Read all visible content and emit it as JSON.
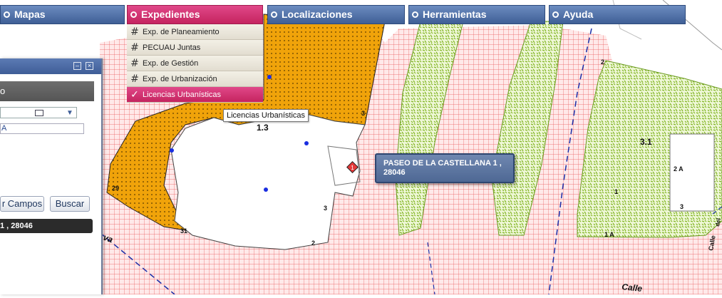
{
  "menu": {
    "items": [
      {
        "label": "Mapas"
      },
      {
        "label": "Expedientes"
      },
      {
        "label": "Localizaciones"
      },
      {
        "label": "Herramientas"
      },
      {
        "label": "Ayuda"
      }
    ]
  },
  "dropdown": {
    "items": [
      {
        "label": "Exp. de Planeamiento"
      },
      {
        "label": "PECUAU Juntas"
      },
      {
        "label": "Exp. de Gestión"
      },
      {
        "label": "Exp. de Urbanización"
      },
      {
        "label": "Licencias Urbanísticas"
      }
    ]
  },
  "tooltip": {
    "text": "Licencias Urbanísticas"
  },
  "popup": {
    "text": "PASEO DE LA CASTELLANA 1 , 28046"
  },
  "panel": {
    "title": "o",
    "input_value": "A",
    "clear_label": "r Campos",
    "search_label": "Buscar",
    "result": "1 , 28046"
  },
  "map": {
    "marker_label": "1",
    "labels": [
      "1.3",
      "3",
      "29",
      "31",
      "3",
      "2",
      "2",
      "3.1",
      "2 A",
      "1",
      "3",
      "1 A",
      "Calle",
      "Calle",
      "del",
      "va"
    ]
  },
  "colors": {
    "menu_blue": "#4f6fa6",
    "menu_active": "#d2336f",
    "orange_parcel": "#f0a30a",
    "green_zone": "#a6cf3a",
    "grid_red": "#e9585a"
  }
}
